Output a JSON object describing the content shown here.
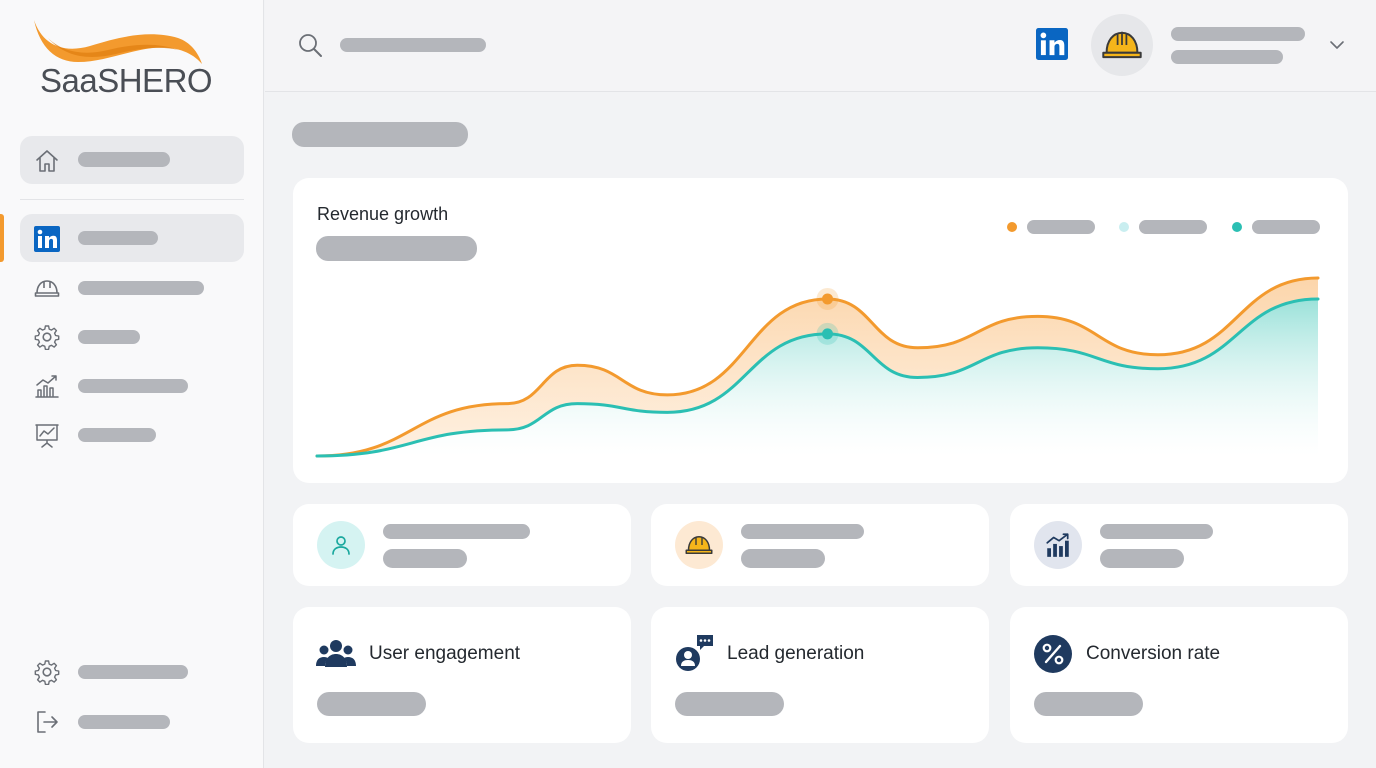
{
  "brand": {
    "logo_text": "SaaSHERO",
    "accent_color": "#f39a2e",
    "teal_color": "#2bbfb3"
  },
  "sidebar": {
    "items": [
      {
        "icon": "home-icon"
      },
      {
        "icon": "linkedin-icon",
        "active": true
      },
      {
        "icon": "helmet-icon"
      },
      {
        "icon": "gear-icon"
      },
      {
        "icon": "bar-chart-icon"
      },
      {
        "icon": "presentation-icon"
      }
    ],
    "footer": [
      {
        "icon": "gear-icon"
      },
      {
        "icon": "logout-icon"
      }
    ]
  },
  "header": {
    "search_icon": "search-icon",
    "linkedin_icon": "linkedin-icon",
    "avatar_icon": "helmet-icon",
    "menu_icon": "chevron-down-icon"
  },
  "chart": {
    "title": "Revenue growth",
    "series_colors": [
      "#f39a2e",
      "#c9eef0",
      "#2bbfb3"
    ]
  },
  "chart_data": {
    "type": "area",
    "title": "Revenue growth",
    "grid": false,
    "legend": "top-right",
    "series": [
      {
        "color": "#f39a2e",
        "values": [
          0,
          30,
          52,
          35,
          90,
          62,
          80,
          58,
          102
        ]
      },
      {
        "color": "#2bbfb3",
        "values": [
          0,
          15,
          30,
          25,
          70,
          45,
          62,
          50,
          90
        ]
      }
    ]
  },
  "stats": [
    {
      "icon": "user-icon",
      "circle_color": "#d5f3f2"
    },
    {
      "icon": "helmet-icon",
      "circle_color": "#fde9d3"
    },
    {
      "icon": "bar-chart-icon",
      "circle_color": "#e1e5ee"
    }
  ],
  "kpis": [
    {
      "label": "User engagement",
      "icon": "users-group-icon"
    },
    {
      "label": "Lead generation",
      "icon": "user-chat-icon"
    },
    {
      "label": "Conversion rate",
      "icon": "percent-icon"
    }
  ]
}
